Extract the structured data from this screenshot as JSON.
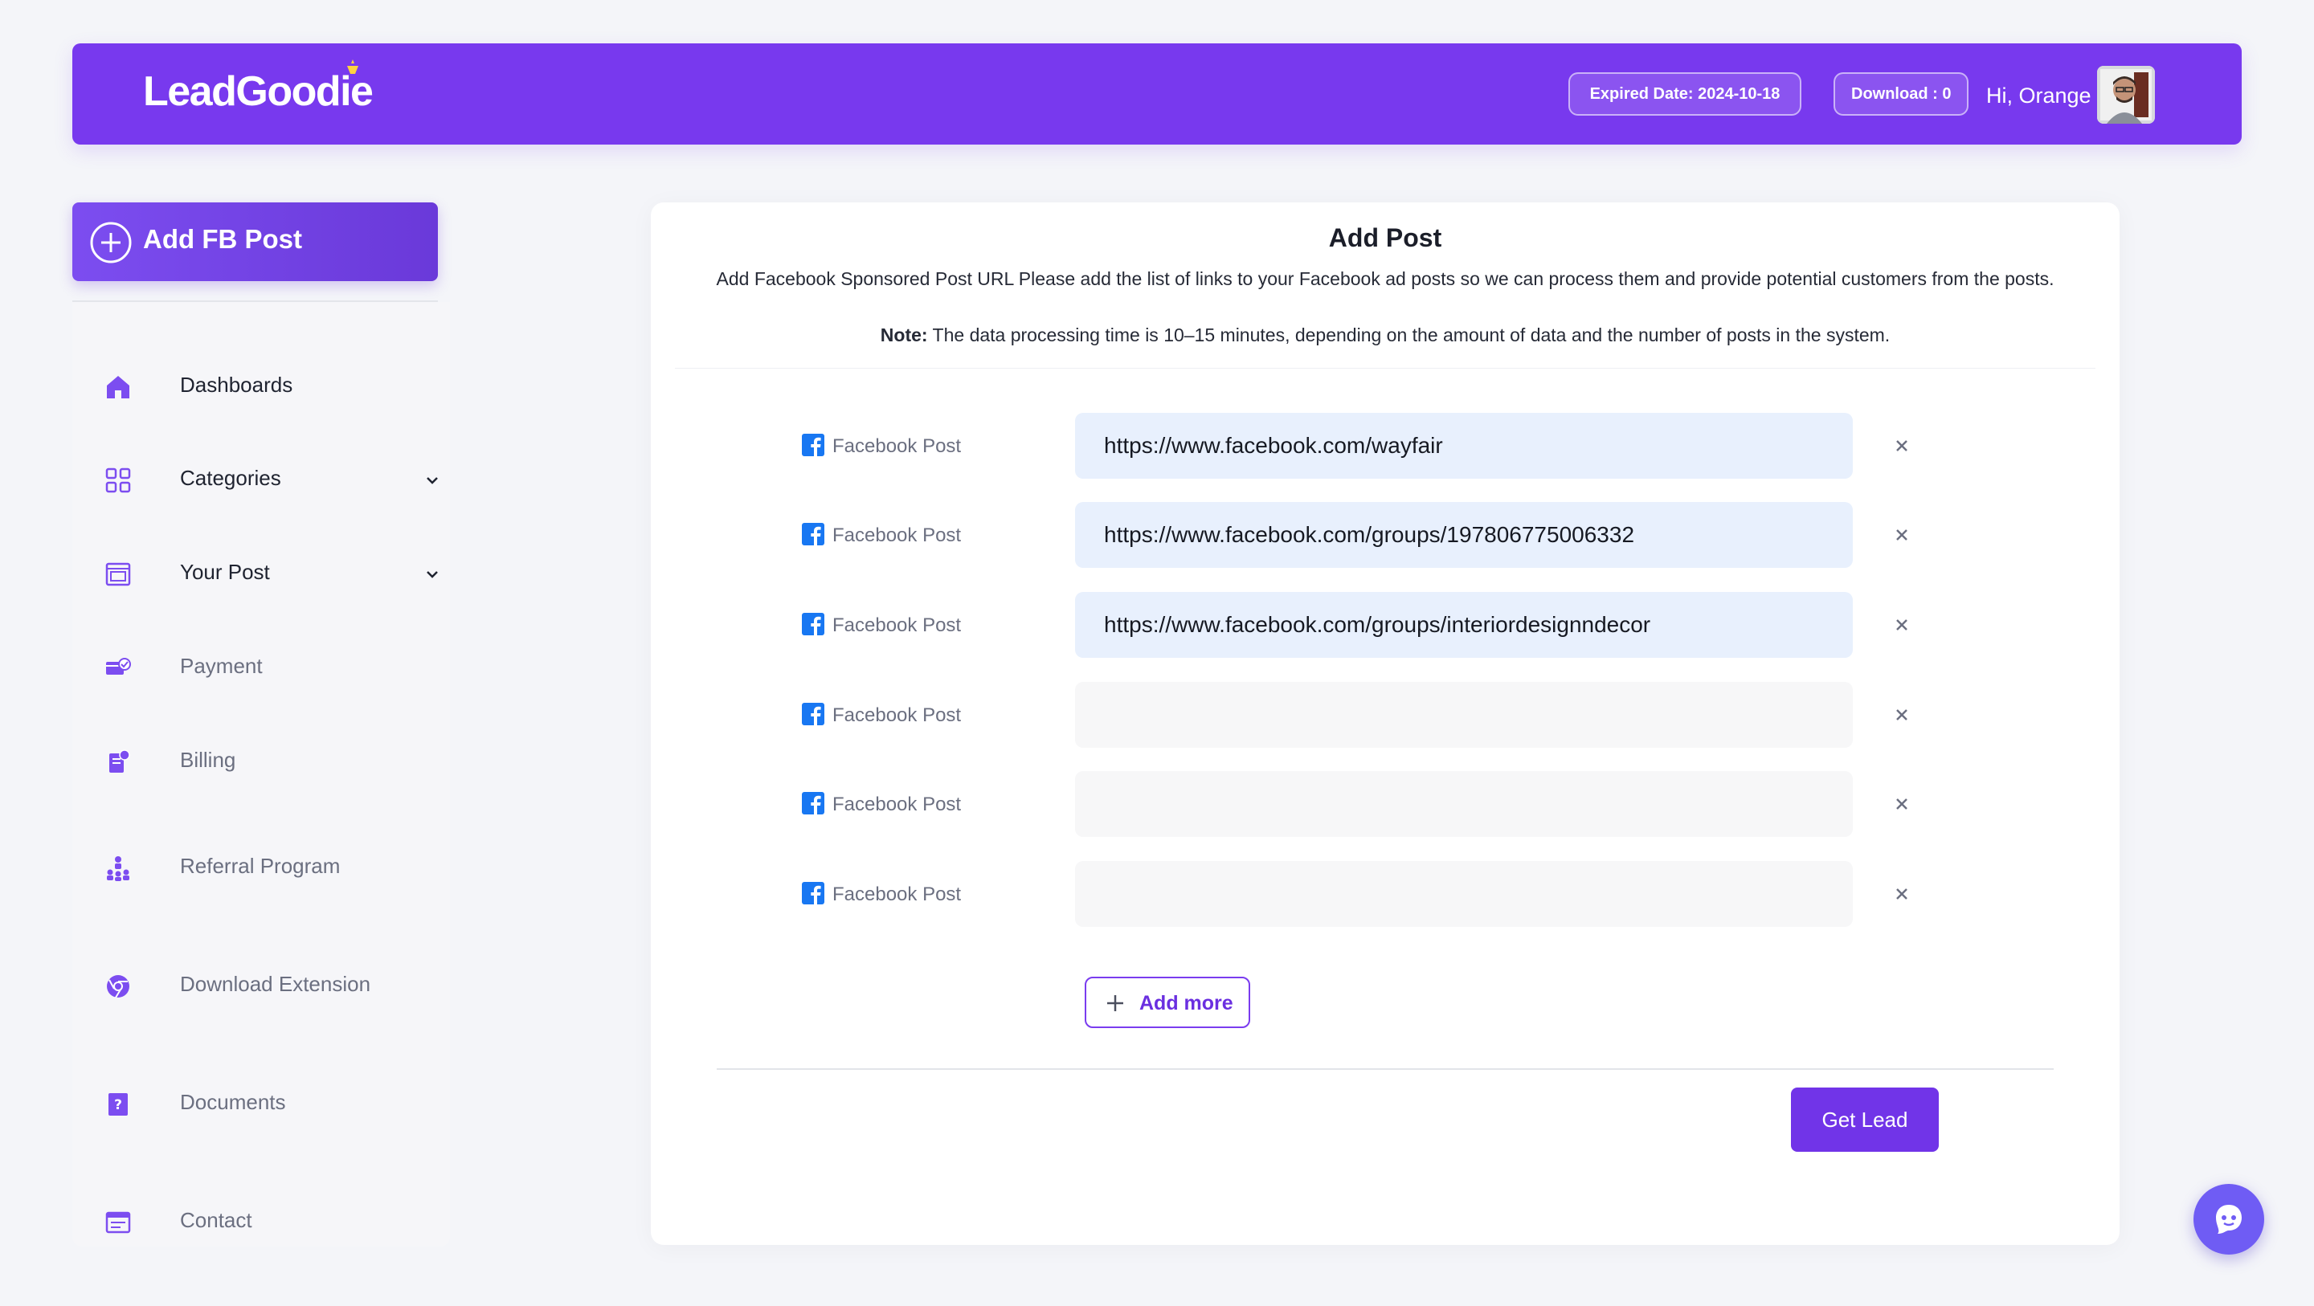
{
  "header": {
    "logo_text": "LeadGoodie",
    "expired_label": "Expired Date: 2024-10-18",
    "download_label": "Download : 0",
    "greeting": "Hi, Orange"
  },
  "sidebar": {
    "add_button_label": "Add FB Post",
    "items": [
      {
        "label": "Dashboards",
        "icon": "home-icon"
      },
      {
        "label": "Categories",
        "icon": "grid-icon"
      },
      {
        "label": "Your Post",
        "icon": "post-icon"
      },
      {
        "label": "Payment",
        "icon": "payment-icon"
      },
      {
        "label": "Billing",
        "icon": "billing-icon"
      },
      {
        "label": "Referral Program",
        "icon": "referral-icon"
      },
      {
        "label": "Download Extension",
        "icon": "chrome-icon"
      },
      {
        "label": "Documents",
        "icon": "document-icon"
      },
      {
        "label": "Contact",
        "icon": "contact-icon"
      }
    ]
  },
  "main": {
    "title": "Add Post",
    "description": "Add Facebook Sponsored Post URL Please add the list of links to your Facebook ad posts so we can process them and provide potential customers from the posts.",
    "note_label": "Note:",
    "note_text": " The data processing time is 10–15 minutes, depending on the amount of data and the number of posts in the system.",
    "post_label": "Facebook Post",
    "posts": [
      {
        "value": "https://www.facebook.com/wayfair"
      },
      {
        "value": "https://www.facebook.com/groups/197806775006332"
      },
      {
        "value": "https://www.facebook.com/groups/interiordesignndecor"
      },
      {
        "value": ""
      },
      {
        "value": ""
      },
      {
        "value": ""
      }
    ],
    "add_more_label": "Add more",
    "get_lead_label": "Get Lead"
  },
  "colors": {
    "brand": "#7839ee",
    "button": "#7134e8",
    "input_filled": "#e8f0fd",
    "input_empty": "#f7f7f8",
    "facebook": "#1877f2"
  }
}
